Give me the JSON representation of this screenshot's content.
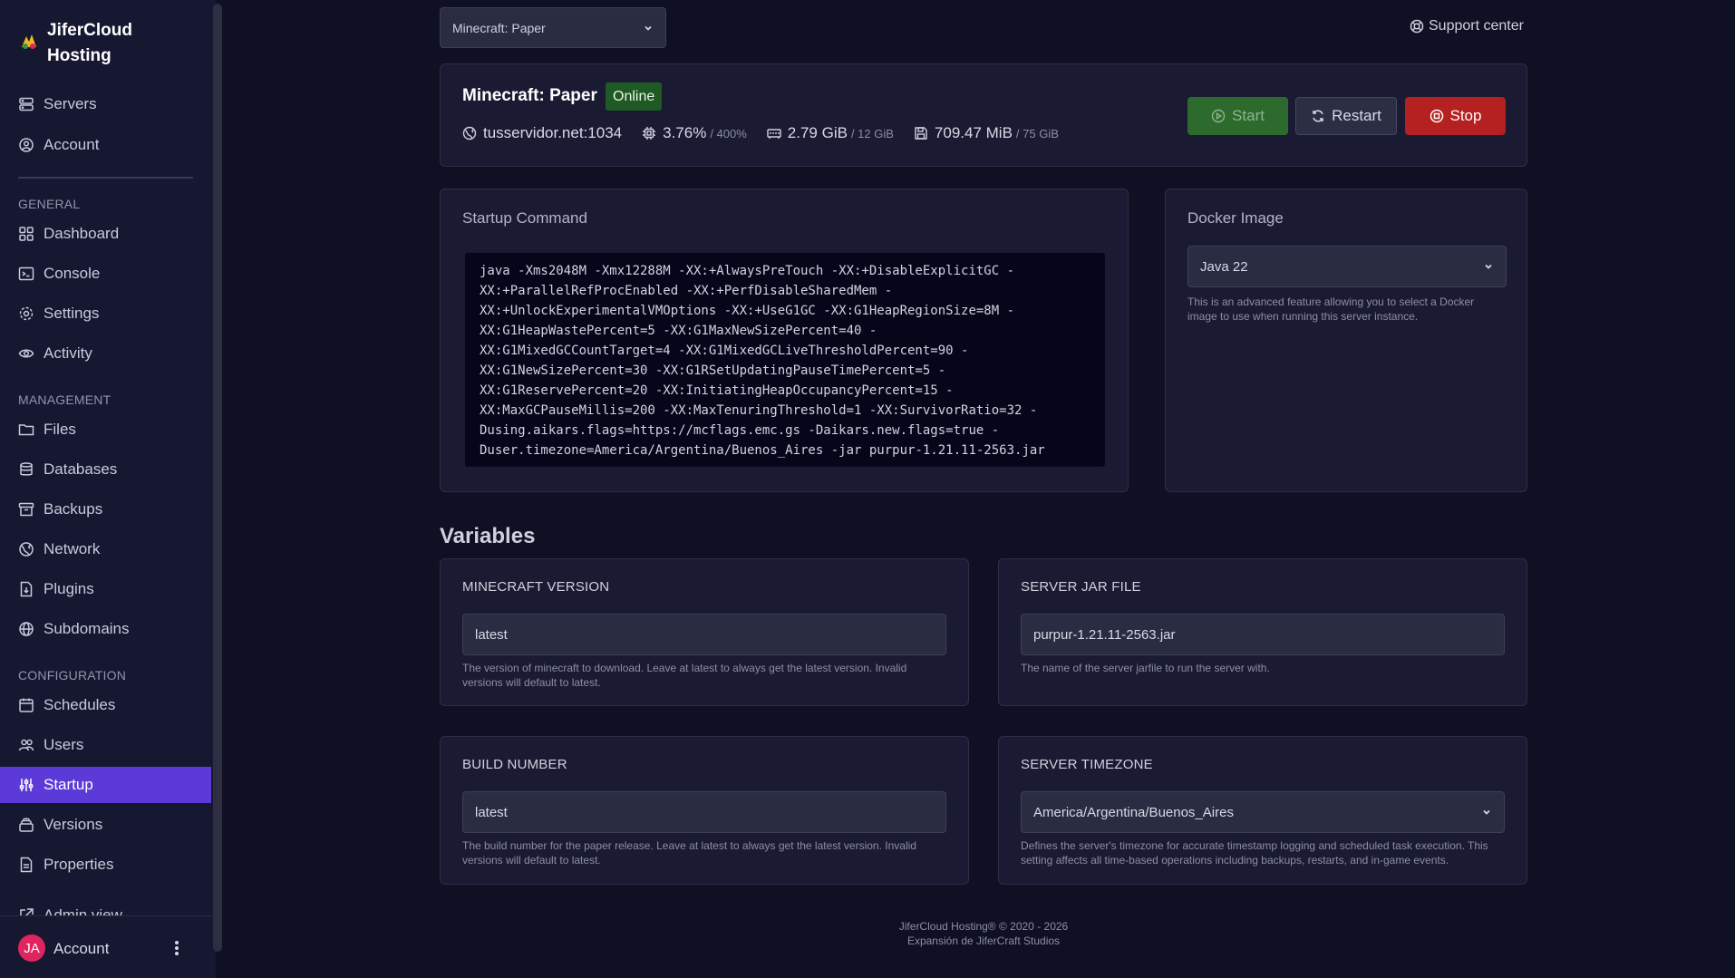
{
  "brand": {
    "name": "JiferCloud Hosting"
  },
  "nav_top": [
    {
      "label": "Servers",
      "icon": "servers-icon"
    },
    {
      "label": "Account",
      "icon": "account-icon"
    }
  ],
  "sections": {
    "general": "GENERAL",
    "management": "MANAGEMENT",
    "configuration": "CONFIGURATION"
  },
  "nav_general": [
    {
      "label": "Dashboard"
    },
    {
      "label": "Console"
    },
    {
      "label": "Settings"
    },
    {
      "label": "Activity"
    }
  ],
  "nav_management": [
    {
      "label": "Files"
    },
    {
      "label": "Databases"
    },
    {
      "label": "Backups"
    },
    {
      "label": "Network"
    },
    {
      "label": "Plugins"
    },
    {
      "label": "Subdomains"
    }
  ],
  "nav_configuration": [
    {
      "label": "Schedules"
    },
    {
      "label": "Users"
    },
    {
      "label": "Startup",
      "active": true
    },
    {
      "label": "Versions"
    },
    {
      "label": "Properties"
    }
  ],
  "nav_admin": {
    "label": "Admin view"
  },
  "sidebar_footer": {
    "initials": "JA",
    "label": "Account"
  },
  "server_select": {
    "value": "Minecraft: Paper"
  },
  "support": {
    "label": "Support center"
  },
  "server": {
    "title": "Minecraft: Paper",
    "status": "Online",
    "address": "tusservidor.net:1034",
    "cpu": "3.76%",
    "cpu_limit": "/ 400%",
    "memory": "2.79 GiB",
    "memory_limit": "/ 12 GiB",
    "disk": "709.47 MiB",
    "disk_limit": "/ 75 GiB",
    "start_label": "Start",
    "restart_label": "Restart",
    "stop_label": "Stop"
  },
  "startup": {
    "title": "Startup Command",
    "command": "java -Xms2048M -Xmx12288M -XX:+AlwaysPreTouch -XX:+DisableExplicitGC -\nXX:+ParallelRefProcEnabled -XX:+PerfDisableSharedMem -\nXX:+UnlockExperimentalVMOptions -XX:+UseG1GC -XX:G1HeapRegionSize=8M -\nXX:G1HeapWastePercent=5 -XX:G1MaxNewSizePercent=40 -\nXX:G1MixedGCCountTarget=4 -XX:G1MixedGCLiveThresholdPercent=90 -\nXX:G1NewSizePercent=30 -XX:G1RSetUpdatingPauseTimePercent=5 -\nXX:G1ReservePercent=20 -XX:InitiatingHeapOccupancyPercent=15 -\nXX:MaxGCPauseMillis=200 -XX:MaxTenuringThreshold=1 -XX:SurvivorRatio=32 -\nDusing.aikars.flags=https://mcflags.emc.gs -Daikars.new.flags=true -\nDuser.timezone=America/Argentina/Buenos_Aires -jar purpur-1.21.11-2563.jar"
  },
  "docker": {
    "title": "Docker Image",
    "value": "Java 22",
    "help": "This is an advanced feature allowing you to select a Docker image to use when running this server instance."
  },
  "variables": {
    "title": "Variables",
    "items": [
      {
        "label": "MINECRAFT VERSION",
        "value": "latest",
        "help": "The version of minecraft to download. Leave at latest to always get the latest version. Invalid versions will default to latest."
      },
      {
        "label": "SERVER JAR FILE",
        "value": "purpur-1.21.11-2563.jar",
        "help": "The name of the server jarfile to run the server with."
      },
      {
        "label": "BUILD NUMBER",
        "value": "latest",
        "help": "The build number for the paper release. Leave at latest to always get the latest version. Invalid versions will default to latest."
      },
      {
        "label": "SERVER TIMEZONE",
        "value": "America/Argentina/Buenos_Aires",
        "help": "Defines the server's timezone for accurate timestamp logging and scheduled task execution. This setting affects all time-based operations including backups, restarts, and in-game events."
      }
    ]
  },
  "footer": {
    "line1": "JiferCloud Hosting® © 2020 - 2026",
    "line2": "Expansión de JiferCraft Studios"
  },
  "colors": {
    "accent": "#5b3ad8",
    "online": "#1f5a24",
    "start": "#2d6a2d",
    "stop": "#b52020"
  }
}
